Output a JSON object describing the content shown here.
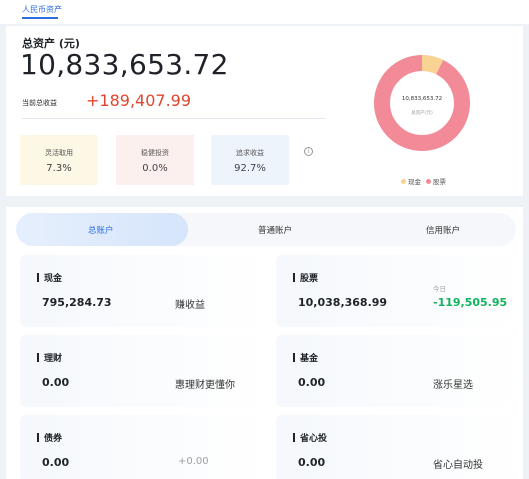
{
  "header": {
    "tab_label": "人民币资产"
  },
  "summary": {
    "total_label": "总资产 (元)",
    "total_value": "10,833,653.72",
    "earn_label": "当前总收益",
    "earn_value": "+189,407.99",
    "mini_cards": [
      {
        "title": "灵活取用",
        "value": "7.3%"
      },
      {
        "title": "稳健投资",
        "value": "0.0%"
      },
      {
        "title": "追求收益",
        "value": "92.7%"
      }
    ],
    "info_icon": "info-circle-icon"
  },
  "donut": {
    "center_value": "10,833,653.72",
    "center_label": "总资产(元)",
    "segments": [
      {
        "name": "现金",
        "fraction": 0.073,
        "color": "#f9d394"
      },
      {
        "name": "股票",
        "fraction": 0.927,
        "color": "#f38a97"
      }
    ]
  },
  "account_tabs": [
    "总账户",
    "普通账户",
    "信用账户"
  ],
  "accounts": [
    {
      "title": "现金",
      "value": "795,284.73",
      "note": "赚收益"
    },
    {
      "title": "股票",
      "value": "10,038,368.99",
      "today_label": "今日",
      "today_value": "-119,505.95"
    },
    {
      "title": "理财",
      "value": "0.00",
      "note": "惠理财更懂你"
    },
    {
      "title": "基金",
      "value": "0.00",
      "note": "涨乐星选"
    },
    {
      "title": "债券",
      "value": "0.00",
      "note": "+0.00"
    },
    {
      "title": "省心投",
      "value": "0.00",
      "note": "省心自动投"
    }
  ],
  "colors": {
    "accent": "#2f6de1",
    "gain": "#e0462f",
    "today_change": "#11b25d"
  }
}
